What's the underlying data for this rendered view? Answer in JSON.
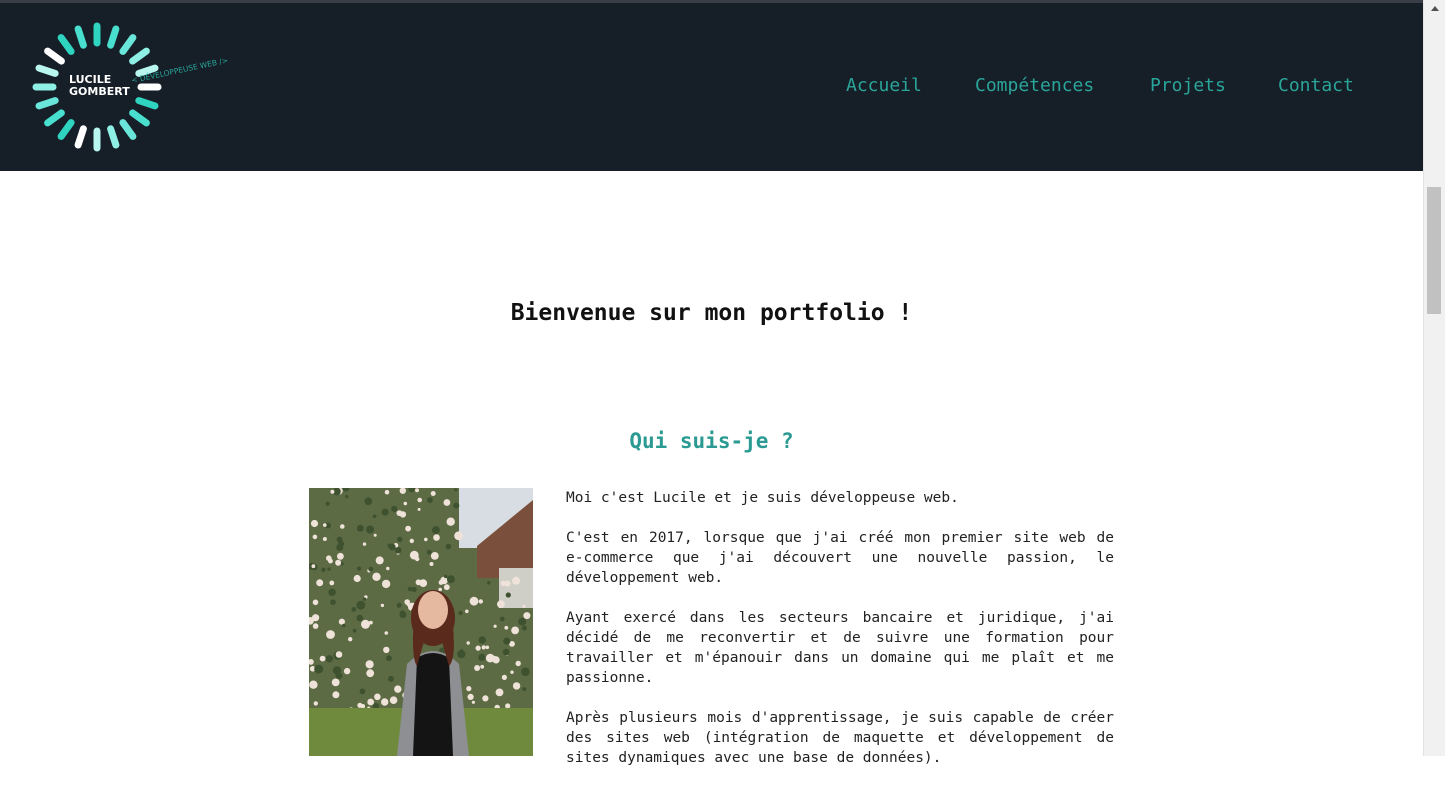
{
  "header": {
    "logo": {
      "name_line1": "LUCILE",
      "name_line2": "GOMBERT",
      "tagline": "< DÉVELOPPEUSE WEB />"
    },
    "nav": [
      {
        "label": "Accueil"
      },
      {
        "label": "Compétences"
      },
      {
        "label": "Projets"
      },
      {
        "label": "Contact"
      }
    ]
  },
  "main": {
    "welcome": "Bienvenue sur mon portfolio !",
    "about": {
      "title": "Qui suis-je ?",
      "paragraphs": [
        "Moi c'est Lucile et je suis développeuse web.",
        "C'est en 2017, lorsque que j'ai créé mon premier site web de e-commerce que j'ai découvert une nouvelle passion, le développement web.",
        "Ayant exercé dans les secteurs bancaire et juridique, j'ai décidé de me reconvertir et de suivre une formation pour travailler et m'épanouir dans un domaine qui me plaît et me passionne.",
        "Après plusieurs mois d'apprentissage, je suis capable de créer des sites web (intégration de maquette et développement de sites dynamiques avec une base de données)."
      ]
    }
  },
  "colors": {
    "header_bg": "#161e28",
    "accent": "#2aa59a",
    "title_accent": "#2a9a92"
  }
}
